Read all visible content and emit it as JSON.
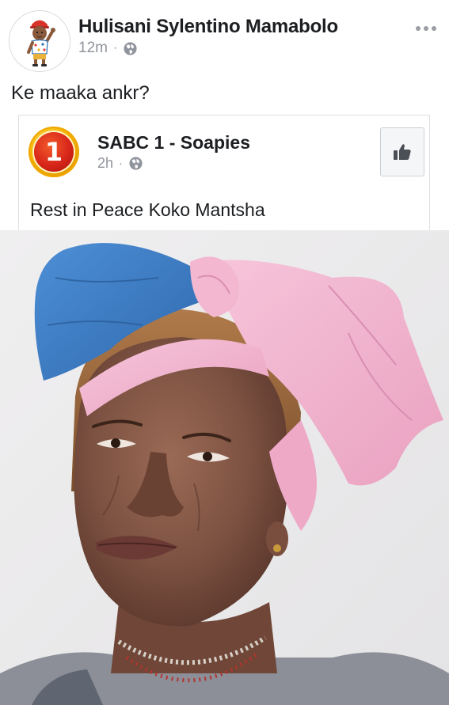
{
  "post": {
    "author_name": "Hulisani Sylentino Mamabolo",
    "time": "12m",
    "privacy_icon": "globe-icon",
    "more_icon": "ellipsis-icon",
    "text": "Ke maaka ankr?"
  },
  "shared_post": {
    "page_name": "SABC 1 - Soapies",
    "time": "2h",
    "privacy_icon": "globe-icon",
    "logo_text": "1",
    "like_icon": "thumbs-up-icon",
    "text": "Rest in Peace Koko Mantsha"
  },
  "colors": {
    "meta_gray": "#90949c",
    "border": "#dddfe2",
    "logo_gold": "#f4b400",
    "logo_red": "#d8261a",
    "headwrap_blue": "#3f7fc4",
    "headwrap_pink": "#f2b5cf"
  }
}
